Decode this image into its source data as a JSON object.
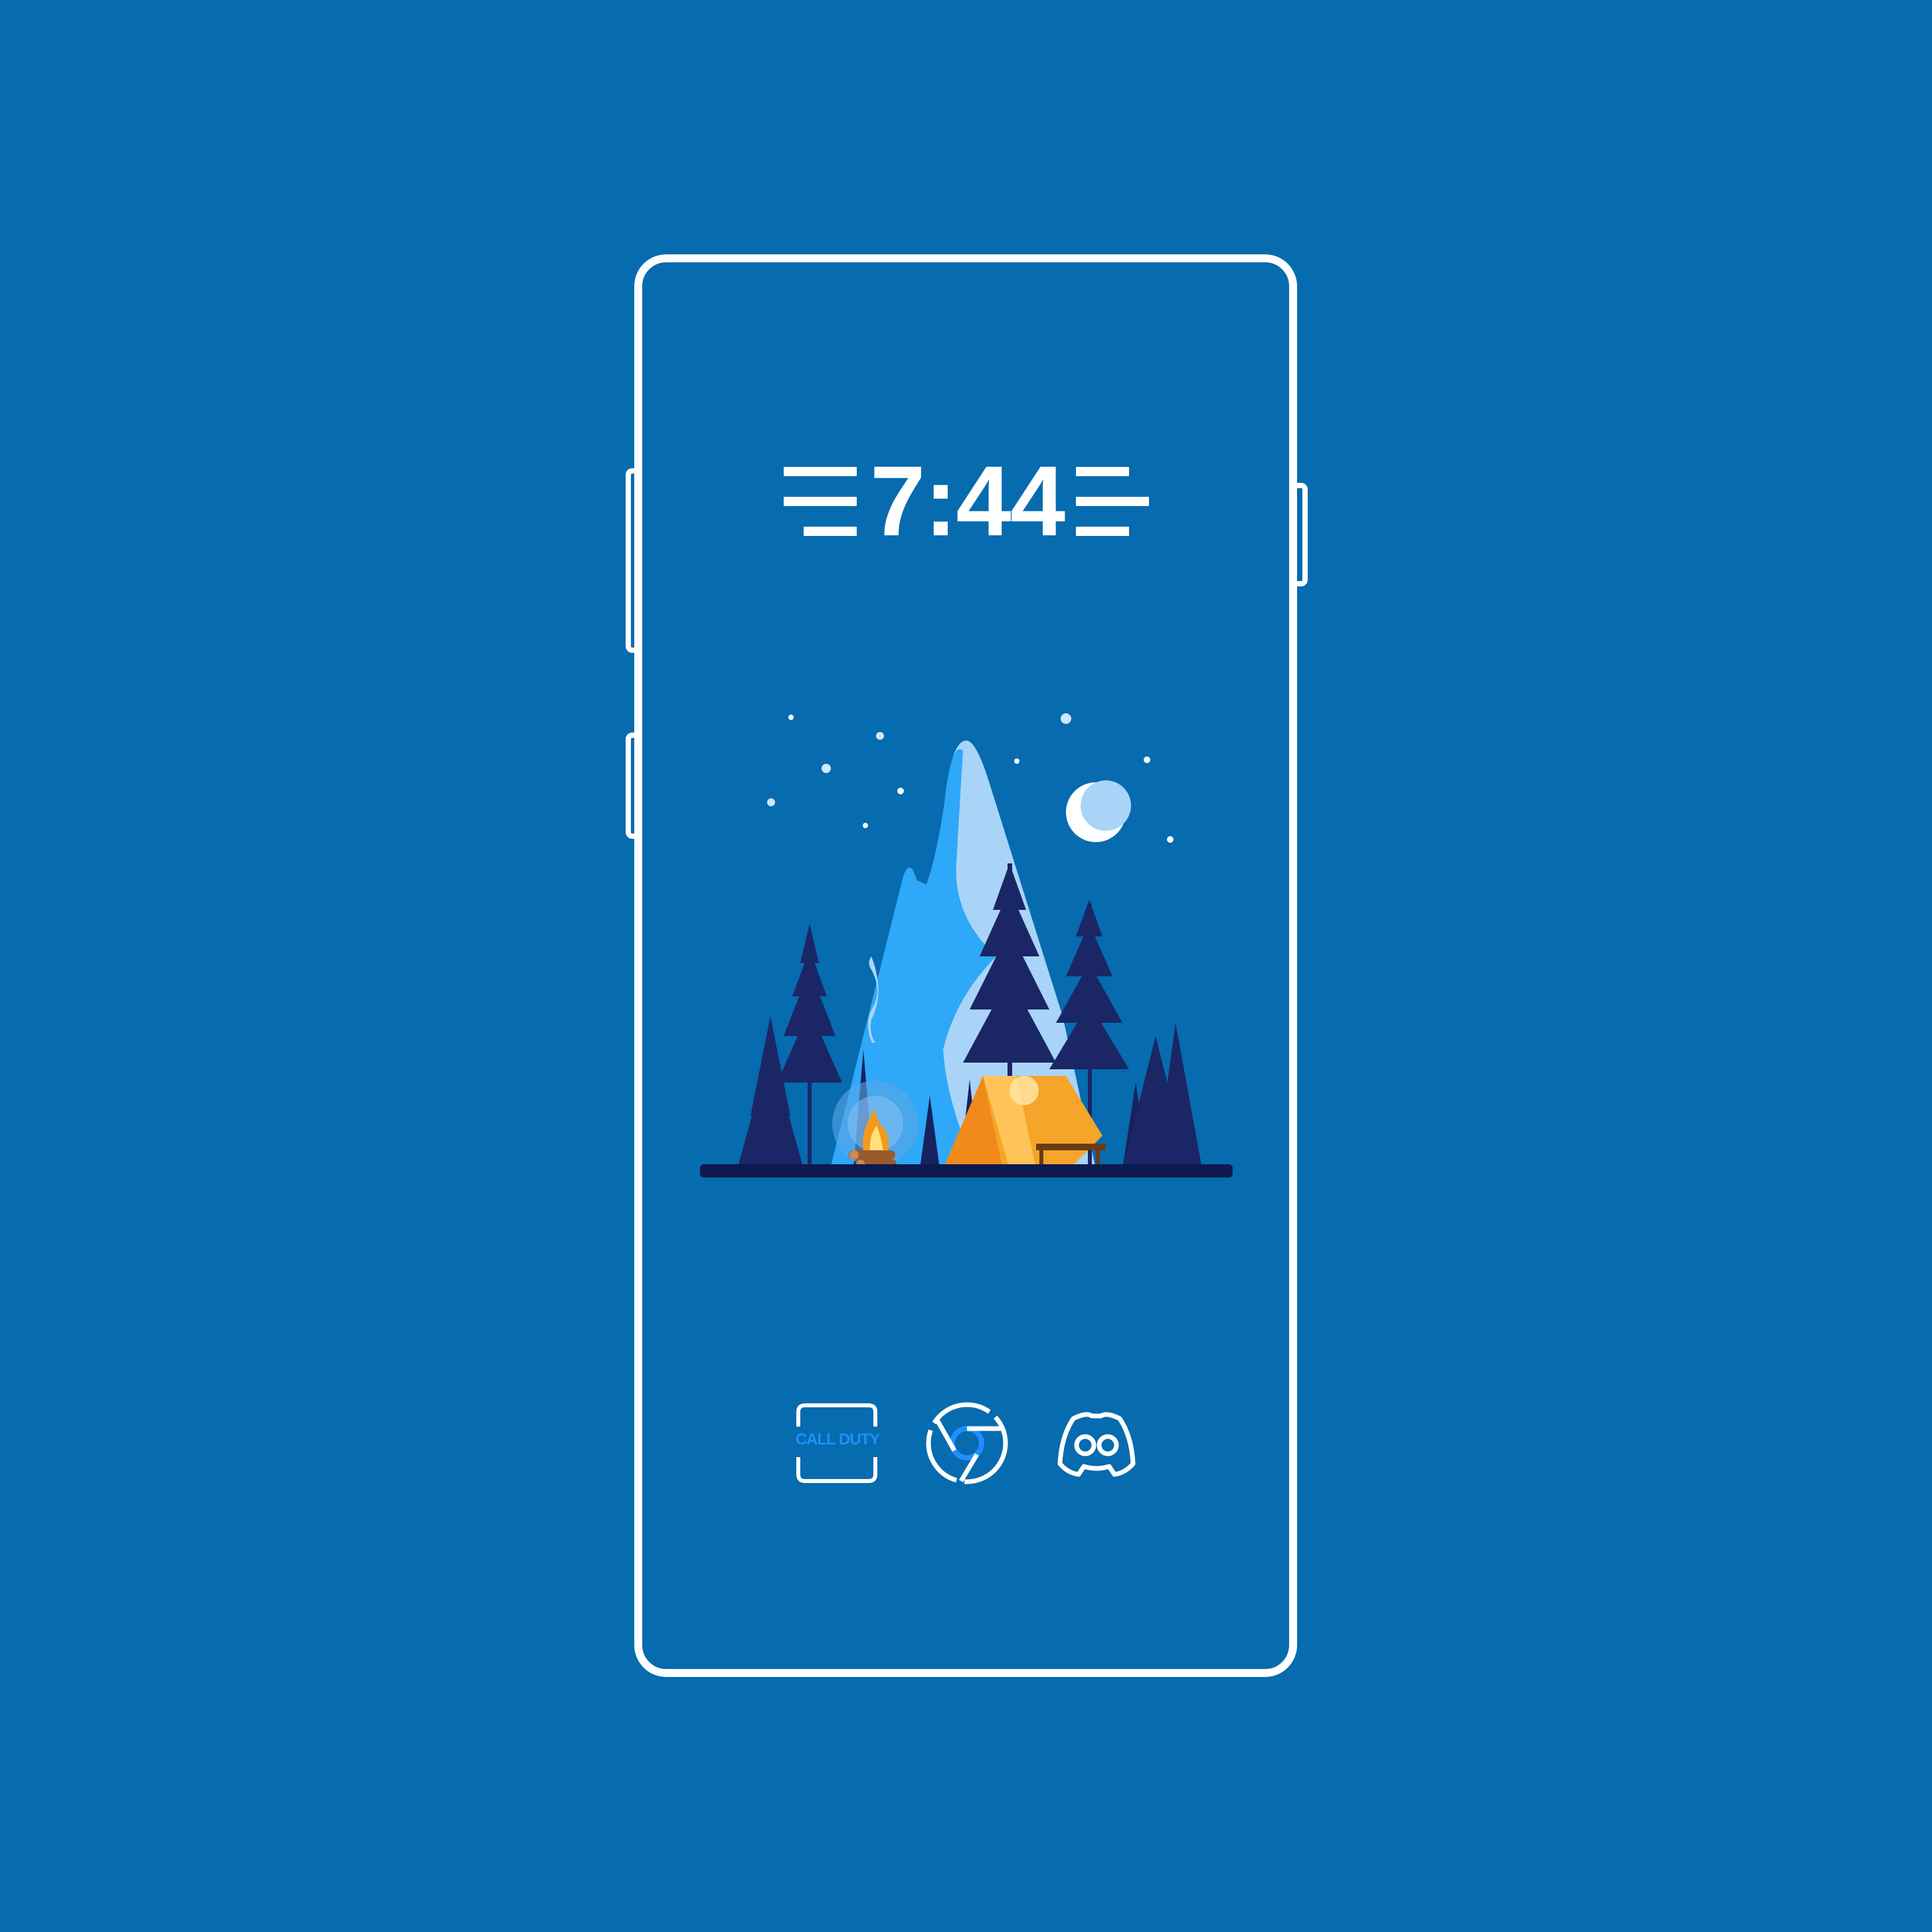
{
  "lockscreen": {
    "time": "7:44",
    "wallpaper_icon": "campsite-night-wallpaper"
  },
  "dock": {
    "apps": [
      {
        "label": "CALL DUTY",
        "icon": "call-of-duty-icon"
      },
      {
        "label": "",
        "icon": "chrome-icon"
      },
      {
        "label": "",
        "icon": "discord-icon"
      }
    ]
  },
  "colors": {
    "background": "#066baf",
    "frame": "#ffffff",
    "sky_mountain_light": "#a9d4f7",
    "sky_mountain_mid": "#2ea8f8",
    "tree_dark": "#1b2666",
    "tent": "#f4a52a",
    "ground": "#0c1a4f",
    "accent_blue": "#1f8fff"
  }
}
